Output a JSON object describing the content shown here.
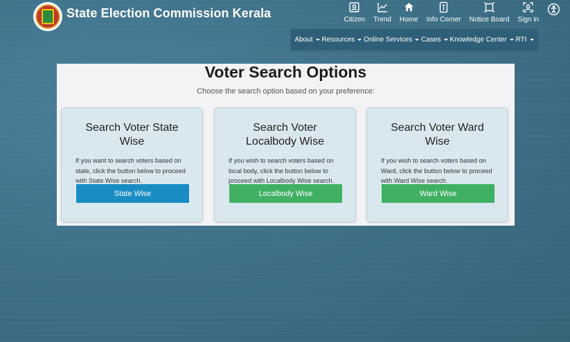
{
  "header": {
    "site_title": "State Election Commission Kerala",
    "top_icons": [
      {
        "label": "Citizen",
        "icon": "citizen-icon"
      },
      {
        "label": "Trend",
        "icon": "trend-icon"
      },
      {
        "label": "Home",
        "icon": "home-icon"
      },
      {
        "label": "Info Corner",
        "icon": "info-icon"
      },
      {
        "label": "Notice Board",
        "icon": "notice-board-icon"
      },
      {
        "label": "Sign in",
        "icon": "sign-in-icon"
      }
    ],
    "accessibility_icon": "accessibility-icon"
  },
  "menu": [
    {
      "label": "About"
    },
    {
      "label": "Resources"
    },
    {
      "label": "Online Services"
    },
    {
      "label": "Cases"
    },
    {
      "label": "Knowledge Center"
    },
    {
      "label": "RTI"
    }
  ],
  "main": {
    "title": "Voter Search Options",
    "subtitle": "Choose the search option based on your preference:",
    "cards": [
      {
        "title": "Search Voter State Wise",
        "description": "If you want to search voters based on state, click the button below to proceed with State Wise search.",
        "button": "State Wise"
      },
      {
        "title": "Search Voter Localbody Wise",
        "description": "If you wish to search voters based on local body, click the button below to proceed with Localbody Wise search.",
        "button": "Localbody Wise"
      },
      {
        "title": "Search Voter Ward Wise",
        "description": "If you wish to search voters based on Ward, click the button below to proceed with Ward Wise search.",
        "button": "Ward Wise"
      }
    ]
  },
  "colors": {
    "background": "#3f7189",
    "menubar": "#2f5f78",
    "button_blue": "#1a8cc4",
    "button_green": "#40b063",
    "card_bg": "#d9e8ee"
  }
}
